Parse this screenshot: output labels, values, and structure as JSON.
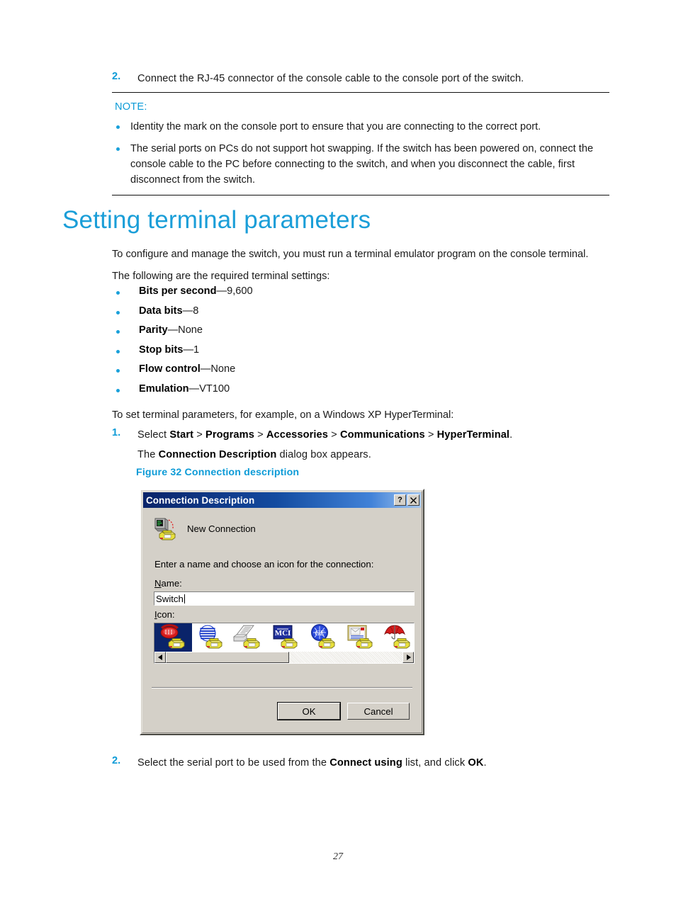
{
  "accent_colors": {
    "heading_blue": "#1a9ed8",
    "step_number_blue": "#0c9bd7",
    "bullet_blue": "#19a0da",
    "caption_blue": "#0c9bd7",
    "dialog_face": "#d4d0c8",
    "titlebar_blue": "#0a246a",
    "selection_blue": "#0a246a"
  },
  "top_step": {
    "number": "2.",
    "text": "Connect the RJ-45 connector of the console cable to the console port of the switch."
  },
  "note": {
    "label": "NOTE:",
    "items": [
      "Identity the mark on the console port to ensure that you are connecting to the correct port.",
      "The serial ports on PCs do not support hot swapping. If the switch has been powered on, connect the console cable to the PC before connecting to the switch, and when you disconnect the cable, first disconnect from the switch."
    ]
  },
  "section": {
    "heading": "Setting terminal parameters",
    "intro_paragraph": "To configure and manage the switch, you must run a terminal emulator program on the console terminal.",
    "lead_in": "The following are the required terminal settings:",
    "settings": [
      {
        "name": "Bits per second",
        "sep": "—9,600"
      },
      {
        "name": "Data bits",
        "sep": "—8"
      },
      {
        "name": "Parity",
        "sep": "—None"
      },
      {
        "name": "Stop bits",
        "sep": "—1"
      },
      {
        "name": "Flow control",
        "sep": "—None"
      },
      {
        "name": "Emulation",
        "sep": "—VT100"
      }
    ],
    "example_line": "To set terminal parameters, for example, on a Windows XP HyperTerminal:"
  },
  "step1": {
    "number": "1.",
    "prefix": "Select ",
    "path": [
      "Start",
      "Programs",
      "Accessories",
      "Communications",
      "HyperTerminal"
    ],
    "path_separator": " > ",
    "suffix": ".",
    "second_line_prefix": "The ",
    "second_line_bold": "Connection Description",
    "second_line_suffix": " dialog box appears."
  },
  "figure": {
    "caption": "Figure 32 Connection description"
  },
  "dialog": {
    "title": "Connection Description",
    "help_button": "?",
    "close_button": "✕",
    "connection_name": "New Connection",
    "instruction": "Enter a name and choose an icon for the connection:",
    "name_label_underlined": "N",
    "name_label_rest": "ame:",
    "name_value": "Switch",
    "icon_label_underlined": "I",
    "icon_label_rest": "con:",
    "icons": [
      {
        "name": "red-telephone-icon",
        "selected": true
      },
      {
        "name": "blue-striped-globe-icon",
        "selected": false
      },
      {
        "name": "fax-papers-icon",
        "selected": false
      },
      {
        "name": "mci-logo-icon",
        "selected": false
      },
      {
        "name": "blue-globe-ge-icon",
        "selected": false
      },
      {
        "name": "mail-documents-icon",
        "selected": false
      },
      {
        "name": "red-umbrella-icon",
        "selected": false
      }
    ],
    "scroll_left_arrow": "◄",
    "scroll_right_arrow": "►",
    "ok_button": "OK",
    "cancel_button": "Cancel"
  },
  "bottom_step": {
    "number": "2.",
    "prefix": "Select the serial port to be used from the ",
    "bold1": "Connect using",
    "middle": " list, and click ",
    "bold2": "OK",
    "suffix": "."
  },
  "footer": {
    "page_number": "27"
  }
}
